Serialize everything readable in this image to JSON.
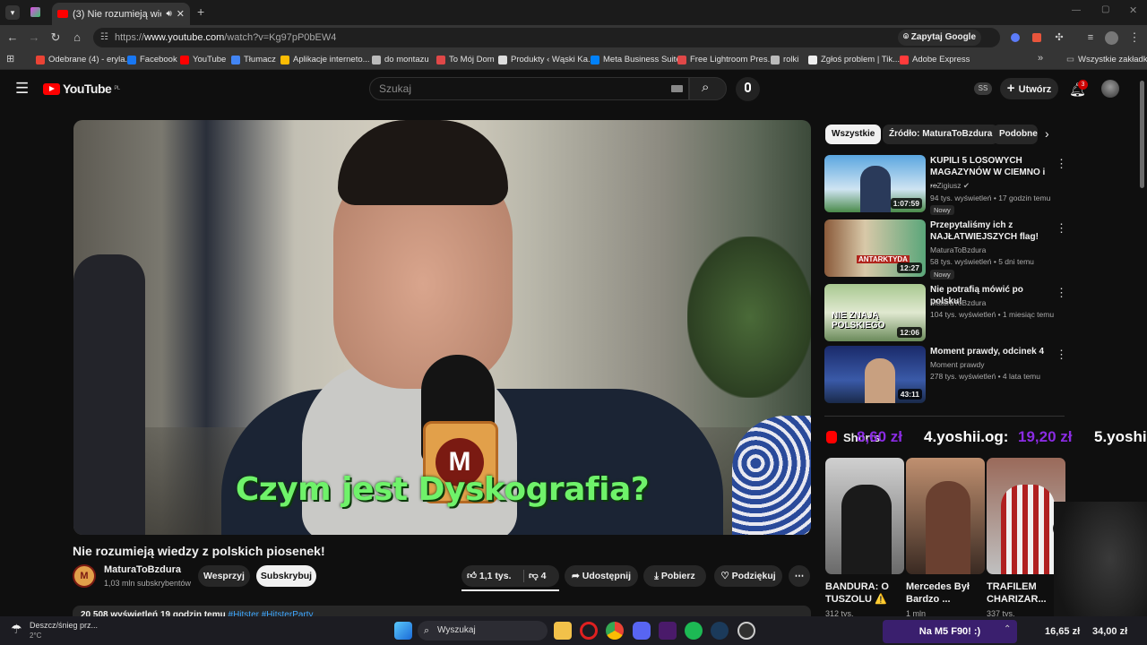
{
  "browser": {
    "tab_title": "(3) Nie rozumieją wiedzy z p",
    "url_prefix": "https://",
    "url_domain": "www.youtube.com",
    "url_path": "/watch?v=Kg97pP0bEW4",
    "ask_google": "Zapytaj Google",
    "new_tab": "+",
    "bookmarks": [
      {
        "label": "Odebrane (4) - eryla...",
        "color": "#ea4335"
      },
      {
        "label": "Facebook",
        "color": "#1877f2"
      },
      {
        "label": "YouTube",
        "color": "#ff0000"
      },
      {
        "label": "Tłumacz",
        "color": "#4285f4"
      },
      {
        "label": "Aplikacje interneto...",
        "color": "#fbbc04"
      },
      {
        "label": "do montazu",
        "color": "#bbbbbb"
      },
      {
        "label": "To Mój Dom",
        "color": "#e04848"
      },
      {
        "label": "Produkty ‹ Wąski Ka...",
        "color": "#dddddd"
      },
      {
        "label": "Meta Business Suite",
        "color": "#0081fb"
      },
      {
        "label": "Free Lightroom Pres...",
        "color": "#e04848"
      },
      {
        "label": "rolki",
        "color": "#bbbbbb"
      },
      {
        "label": "Zgłoś problem | Tik...",
        "color": "#eeeeee"
      },
      {
        "label": "Adobe Express",
        "color": "#ff3b3b"
      }
    ],
    "all_bookmarks": "Wszystkie zakładki"
  },
  "yt": {
    "logo": "YouTube",
    "logo_region": "PL",
    "search_placeholder": "Szukaj",
    "user_initials": "SS",
    "create_label": "Utwórz",
    "notifications": "3"
  },
  "video": {
    "subtitle": "Czym jest Dyskografia?",
    "title": "Nie rozumieją wiedzy z polskich piosenek!",
    "channel": "MaturaToBzdura",
    "channel_initial": "M",
    "subscribers": "1,03 mln subskrybentów",
    "support": "Wesprzyj",
    "subscribe": "Subskrybuj",
    "likes": "1,1 tys.",
    "dislikes": "4",
    "share": "Udostępnij",
    "download": "Pobierz",
    "thanks": "Podziękuj",
    "desc_views": "20 508 wyświetleń  19 godzin temu",
    "desc_tags": "#Hitster #HitsterParty"
  },
  "chips": [
    "Wszystkie",
    "Źródło: MaturaToBzdura",
    "Podobne"
  ],
  "recommended": [
    {
      "title": "KUPILI 5 LOSOWYCH MAGAZYNÓW W CIEMNO i ...",
      "channel": "reZigiusz",
      "meta": "94 tys. wyświetleń • 17 godzin temu",
      "badge": "Nowy",
      "duration": "1:07:59"
    },
    {
      "title": "Przepytaliśmy ich z NAJŁATWIEJSZYCH flag!",
      "channel": "MaturaToBzdura",
      "meta": "58 tys. wyświetleń • 5 dni temu",
      "badge": "Nowy",
      "duration": "12:27",
      "thumb_text": "ANTARKTYDA"
    },
    {
      "title": "Nie potrafią mówić po polsku!",
      "channel": "MaturaToBzdura",
      "meta": "104 tys. wyświetleń • 1 miesiąc temu",
      "badge": "",
      "duration": "12:06",
      "thumb_text": "NIE ZNAJĄ POLSKIEGO"
    },
    {
      "title": "Moment prawdy, odcinek 4",
      "channel": "Moment prawdy",
      "meta": "278 tys. wyświetleń • 4 lata temu",
      "badge": "",
      "duration": "43:11"
    }
  ],
  "shorts": {
    "label": "Shorts",
    "overlay_1": "8,60 zł",
    "overlay_2": "4.yoshii.og:",
    "overlay_3": "19,20 zł",
    "overlay_4": "5.yoshi",
    "items": [
      {
        "title": "BANDURA: O TUSZOLU ⚠️",
        "views": "312 tys."
      },
      {
        "title": "Mercedes Był Bardzo ...",
        "views": "1 mln"
      },
      {
        "title": "TRAFILEM CHARIZAR...",
        "views": "337 tys."
      }
    ]
  },
  "taskbar": {
    "weather": "Deszcz/śnieg prz...",
    "temp": "2°C",
    "search": "Wyszukaj",
    "ticker": "Na M5 F90! :)",
    "price_1": "16,65 zł",
    "price_2": "34,00 zł"
  }
}
